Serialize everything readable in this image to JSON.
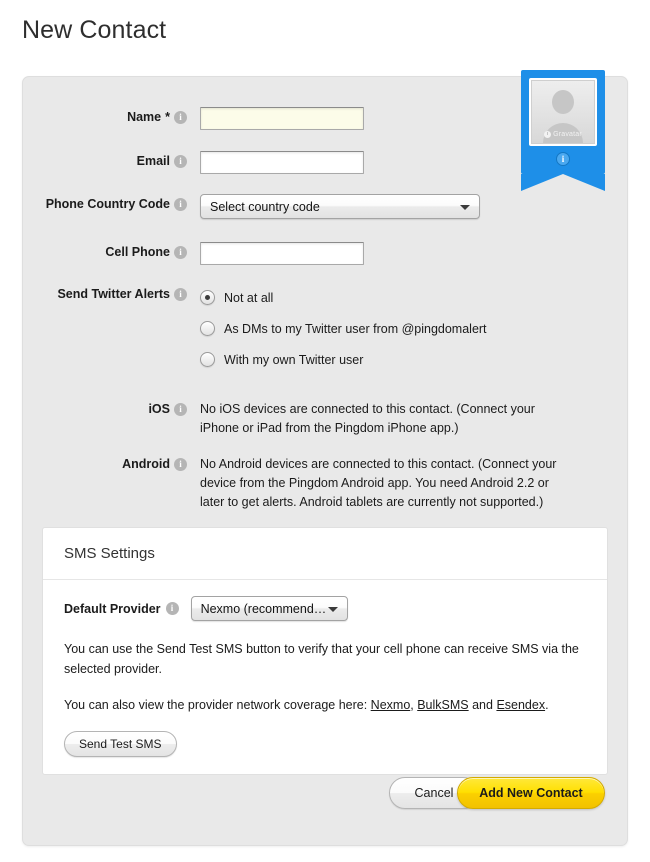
{
  "page": {
    "title": "New Contact"
  },
  "form": {
    "fields": [
      {
        "label": "Name",
        "required_marker": "*",
        "info_icon": "info-icon",
        "type": "text",
        "value": "",
        "placeholder": ""
      },
      {
        "label": "Email",
        "info_icon": "info-icon",
        "type": "text",
        "value": "",
        "placeholder": ""
      },
      {
        "label": "Phone Country Code",
        "info_icon": "info-icon",
        "type": "select",
        "value": "Select country code",
        "arrow_icon": "chevron-down-icon"
      },
      {
        "label": "Cell Phone",
        "info_icon": "info-icon",
        "type": "text",
        "value": "",
        "placeholder": ""
      }
    ],
    "twitter": {
      "label": "Send Twitter Alerts",
      "info_icon": "info-icon",
      "options": [
        {
          "label": "Not at all",
          "selected": true
        },
        {
          "label": "As DMs to my Twitter user from @pingdomalert",
          "selected": false
        },
        {
          "label": "With my own Twitter user",
          "selected": false
        }
      ]
    },
    "ios": {
      "label": "iOS",
      "info_icon": "info-icon",
      "text": "No iOS devices are connected to this contact. (Connect your iPhone or iPad from the Pingdom iPhone app.)"
    },
    "android": {
      "label": "Android",
      "info_icon": "info-icon",
      "text": "No Android devices are connected to this contact. (Connect your device from the Pingdom Android app. You need Android 2.2 or later to get alerts. Android tablets are currently not supported.)"
    }
  },
  "sms": {
    "header": "SMS Settings",
    "provider_label": "Default Provider",
    "provider_info_icon": "info-icon",
    "provider_value": "Nexmo (recommend…",
    "provider_arrow_icon": "chevron-down-icon",
    "paragraph_1": "You can use the Send Test SMS button to verify that your cell phone can receive SMS via the selected provider.",
    "paragraph_2_prefix": "You can also view the provider network coverage here: ",
    "links": [
      {
        "label": "Nexmo"
      },
      {
        "label": "BulkSMS"
      },
      {
        "label": "Esendex"
      }
    ],
    "paragraph_2_sep1": ", ",
    "paragraph_2_sep2": " and ",
    "paragraph_2_suffix": ".",
    "test_button": "Send Test SMS"
  },
  "actions": {
    "cancel": "Cancel",
    "submit": "Add New Contact"
  },
  "gravatar": {
    "wordmark": "Gravatar",
    "logo_icon": "gravatar-logo-icon",
    "info_icon": "info-icon"
  },
  "colors": {
    "accent_blue": "#1e8fe8",
    "primary_yellow": "#ffdf00",
    "panel_gray": "#e9e9e9",
    "highlight_field": "#fcfce9"
  }
}
